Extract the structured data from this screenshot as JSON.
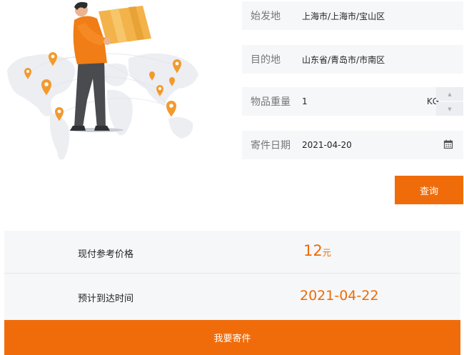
{
  "form": {
    "origin": {
      "label": "始发地",
      "value": "上海市/上海市/宝山区"
    },
    "destination": {
      "label": "目的地",
      "value": "山东省/青岛市/市南区"
    },
    "weight": {
      "label": "物品重量",
      "value": "1",
      "unit": "KG"
    },
    "date": {
      "label": "寄件日期",
      "value": "2021-04-20"
    },
    "query_button": "查询"
  },
  "result": {
    "price_label": "现付参考价格",
    "price_value": "12",
    "price_unit": "元",
    "arrival_label": "预计到达时间",
    "arrival_value": "2021-04-22"
  },
  "send_button": "我要寄件",
  "colors": {
    "accent": "#f06c0a",
    "field_bg": "#f6f7f9"
  },
  "icons": [
    "world-map-illustration",
    "calendar-icon",
    "stepper-up-icon",
    "stepper-down-icon"
  ]
}
